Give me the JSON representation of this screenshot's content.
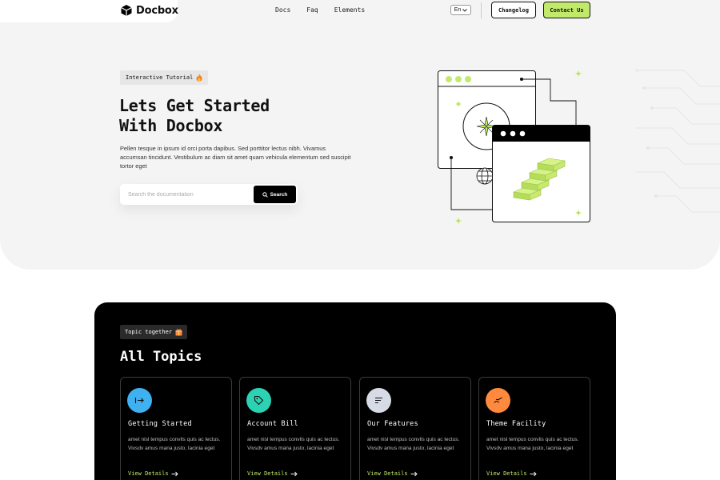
{
  "header": {
    "logo_text": "Docbox",
    "nav": [
      "Docs",
      "Faq",
      "Elements"
    ],
    "lang": "En",
    "changelog": "Changelog",
    "contact": "Contact Us"
  },
  "hero": {
    "badge": "Interactive Tutorial",
    "title_line1": "Lets Get Started",
    "title_line2": "With Docbox",
    "description": "Pellen tesque in ipsum id orci porta dapibus. Sed porttitor lectus nibh. Vivamus accumsan tincidunt. Vestibulum ac diam sit amet quam vehicula elementum sed suscipit tortor eget",
    "search_placeholder": "Search the documentation",
    "search_button": "Search"
  },
  "topics": {
    "badge": "Topic together",
    "title": "All Topics",
    "link_label": "View Details",
    "cards": [
      {
        "title": "Getting Started",
        "icon": "arrow-right-to-line-icon",
        "color": "#3fb0f0",
        "desc": "amet nisl tempus convlis quis ac lectus. Vivsdv amus mana justo, lacinia eget"
      },
      {
        "title": "Account Bill",
        "icon": "tag-icon",
        "color": "#2bd3b4",
        "desc": "amet nisl tempus convlis quis ac lectus. Vivsdv amus mana justo, lacinia eget"
      },
      {
        "title": "Our Features",
        "icon": "text-lines-icon",
        "color": "#d7dbe6",
        "desc": "amet nisl tempus convlis quis ac lectus. Vivsdv amus mana justo, lacinia eget"
      },
      {
        "title": "Theme Facility",
        "icon": "brush-icon",
        "color": "#ff8a3d",
        "desc": "amet nisl tempus convlis quis ac lectus. Vivsdv amus mana justo, lacinia eget"
      }
    ]
  },
  "colors": {
    "accent": "#c2ea6a",
    "dark": "#000000",
    "hero_bg": "#f4f4f4"
  }
}
